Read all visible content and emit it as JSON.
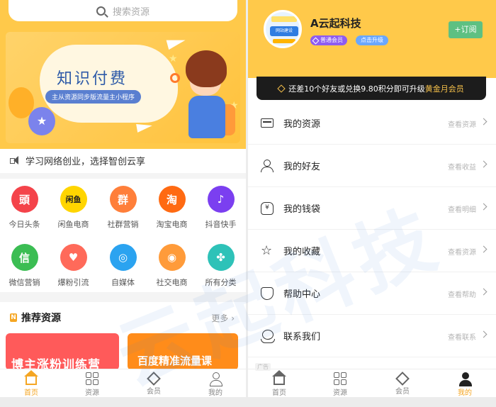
{
  "left": {
    "search": {
      "placeholder": "搜索资源"
    },
    "banner": {
      "title": "知识付费",
      "subtitle": "主从资源同步版流量主小程序"
    },
    "notice": "学习网络创业，选择智创云享",
    "grid": [
      {
        "label": "今日头条",
        "icon": "toutiao-icon",
        "color": "#f4434a",
        "glyph": "頭"
      },
      {
        "label": "闲鱼电商",
        "icon": "xianyu-icon",
        "color": "#ffd500",
        "glyph": "闲鱼"
      },
      {
        "label": "社群营销",
        "icon": "community-icon",
        "color": "#ff7f3a",
        "glyph": "群"
      },
      {
        "label": "淘宝电商",
        "icon": "taobao-icon",
        "color": "#ff6a12",
        "glyph": "淘"
      },
      {
        "label": "抖音快手",
        "icon": "douyin-icon",
        "color": "#7b3ff0",
        "glyph": "♪"
      },
      {
        "label": "微信营销",
        "icon": "wechat-icon",
        "color": "#3bbd53",
        "glyph": "信"
      },
      {
        "label": "爆粉引流",
        "icon": "heart-icon",
        "color": "#ff6a5a",
        "glyph": "♥"
      },
      {
        "label": "自媒体",
        "icon": "media-icon",
        "color": "#2ba3f0",
        "glyph": "◎"
      },
      {
        "label": "社交电商",
        "icon": "chat-bubble-icon",
        "color": "#ff9b3a",
        "glyph": "◉"
      },
      {
        "label": "所有分类",
        "icon": "category-icon",
        "color": "#2ec2b8",
        "glyph": "✤"
      }
    ],
    "recommend": {
      "title": "推荐资源",
      "more": "更多",
      "cards": [
        "博主涨粉训练营",
        "百度精准流量课"
      ]
    },
    "tabs": [
      {
        "label": "首页",
        "active": true
      },
      {
        "label": "资源",
        "active": false
      },
      {
        "label": "会员",
        "active": false
      },
      {
        "label": "我的",
        "active": false
      }
    ]
  },
  "right": {
    "profile": {
      "name": "A云起科技",
      "avatar_text": "网站建设",
      "member_badge": "普通会员",
      "upgrade_badge": "点击升级",
      "subscribe": "+订阅"
    },
    "vip_bar": {
      "prefix": "还差",
      "friends": "10",
      "mid": "个好友或兑换",
      "points": "9.80",
      "suffix": "积分即可升级",
      "level": "黄金月会员"
    },
    "menu": [
      {
        "label": "我的资源",
        "hint": "查看资源",
        "icon": "card-icon"
      },
      {
        "label": "我的好友",
        "hint": "查看收益",
        "icon": "user-icon"
      },
      {
        "label": "我的钱袋",
        "hint": "查看明细",
        "icon": "wallet-icon"
      },
      {
        "label": "我的收藏",
        "hint": "查看资源",
        "icon": "star-icon"
      },
      {
        "label": "帮助中心",
        "hint": "查看帮助",
        "icon": "help-icon"
      },
      {
        "label": "联系我们",
        "hint": "查看联系",
        "icon": "contact-icon"
      }
    ],
    "ad_label": "广告",
    "tabs": [
      {
        "label": "首页",
        "active": false
      },
      {
        "label": "资源",
        "active": false
      },
      {
        "label": "会员",
        "active": false
      },
      {
        "label": "我的",
        "active": true
      }
    ]
  },
  "watermark": {
    "text": "云起科技"
  },
  "colors": {
    "brand": "#ffc94a",
    "accent": "#f5a623",
    "subscribe": "#5ec082"
  }
}
